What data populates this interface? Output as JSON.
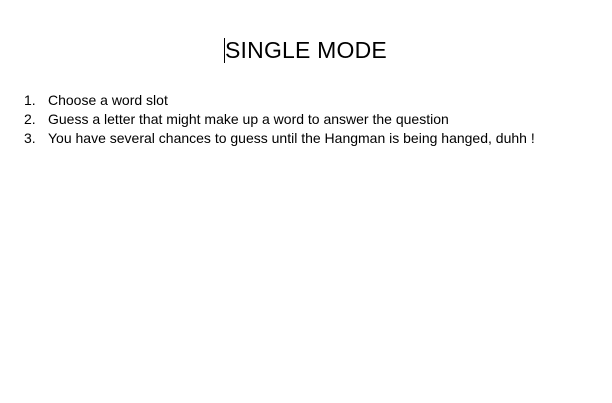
{
  "heading": "SINGLE MODE",
  "steps": [
    {
      "number": "1.",
      "text": "Choose a word slot"
    },
    {
      "number": "2.",
      "text": "Guess a letter that might make up a word to answer the question"
    },
    {
      "number": "3.",
      "text": "You have several chances to guess until the Hangman is being hanged, duhh !"
    }
  ]
}
